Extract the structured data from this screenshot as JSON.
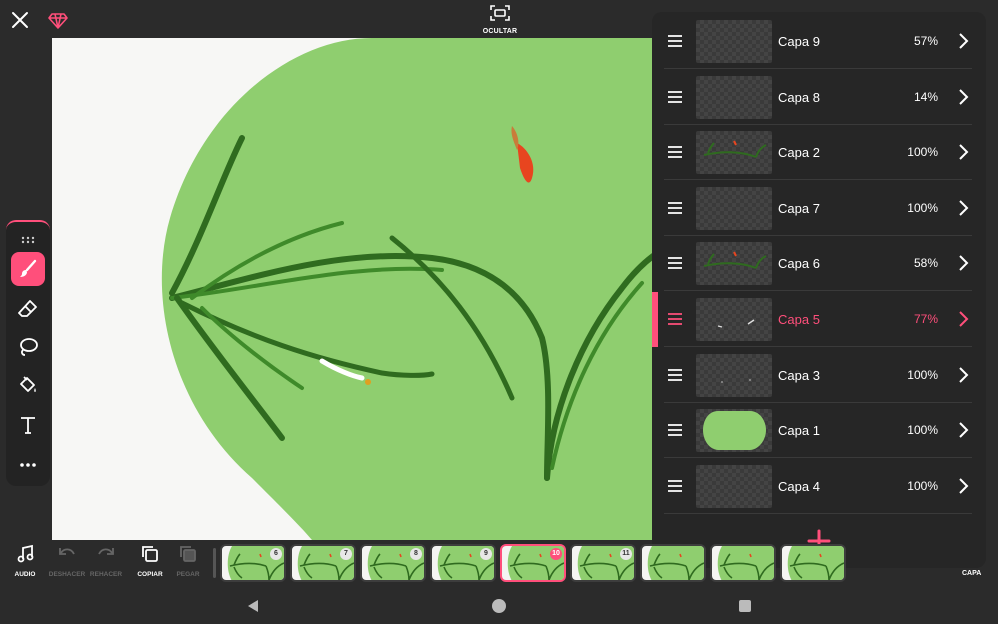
{
  "top_bar": {
    "hide_label": "OCULTAR"
  },
  "icons": {
    "close": "close-icon",
    "gem": "gem-icon",
    "hide": "hide-ui-icon",
    "brush": "brush-icon",
    "eraser": "eraser-icon",
    "lasso": "lasso-icon",
    "fill": "paint-bucket-icon",
    "text": "text-icon",
    "more": "more-icon",
    "drag": "drag-handle-icon",
    "chevron": "chevron-right-icon",
    "add": "plus-icon"
  },
  "colors": {
    "accent": "#ff4f7b",
    "canvas_green": "#8fce6f",
    "leaf_dark": "#2f6b1f",
    "leaf_red": "#e8451f"
  },
  "layers": [
    {
      "name": "Capa 9",
      "opacity": "57%",
      "selected": false,
      "thumb": "empty"
    },
    {
      "name": "Capa 8",
      "opacity": "14%",
      "selected": false,
      "thumb": "empty"
    },
    {
      "name": "Capa 2",
      "opacity": "100%",
      "selected": false,
      "thumb": "strokes"
    },
    {
      "name": "Capa 7",
      "opacity": "100%",
      "selected": false,
      "thumb": "empty"
    },
    {
      "name": "Capa 6",
      "opacity": "58%",
      "selected": false,
      "thumb": "strokes"
    },
    {
      "name": "Capa 5",
      "opacity": "77%",
      "selected": true,
      "thumb": "marks"
    },
    {
      "name": "Capa 3",
      "opacity": "100%",
      "selected": false,
      "thumb": "dots"
    },
    {
      "name": "Capa 1",
      "opacity": "100%",
      "selected": false,
      "thumb": "blob"
    },
    {
      "name": "Capa 4",
      "opacity": "100%",
      "selected": false,
      "thumb": "empty"
    }
  ],
  "bottom_tools": {
    "audio": "AUDIO",
    "undo": "DESHACER",
    "redo": "REHACER",
    "copy": "COPIAR",
    "paste": "PEGAR",
    "layer": "CAPA"
  },
  "frames": [
    {
      "number": "6",
      "current": false
    },
    {
      "number": "7",
      "current": false
    },
    {
      "number": "8",
      "current": false
    },
    {
      "number": "9",
      "current": false
    },
    {
      "number": "10",
      "current": true
    },
    {
      "number": "11",
      "current": false
    },
    {
      "number": "",
      "current": false
    },
    {
      "number": "",
      "current": false
    },
    {
      "number": "",
      "current": false
    }
  ]
}
